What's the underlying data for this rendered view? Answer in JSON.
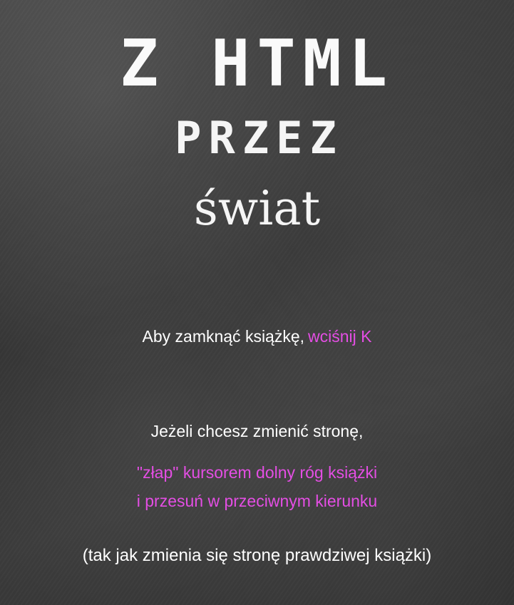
{
  "title": {
    "line1": "Z HTML",
    "line2": "PRZEZ",
    "line3": "świat"
  },
  "close_hint": {
    "text": "Aby zamknąć książkę,",
    "action": "wciśnij K"
  },
  "page_turn_hint": {
    "intro": "Jeżeli chcesz zmienić stronę,",
    "action_line1": "\"złap\" kursorem dolny róg książki",
    "action_line2": "i przesuń w przeciwnym kierunku",
    "note": "(tak jak zmienia się stronę prawdziwej książki)"
  },
  "colors": {
    "background": "#3b3b3b",
    "text": "#ffffff",
    "accent": "#e44ee4"
  }
}
